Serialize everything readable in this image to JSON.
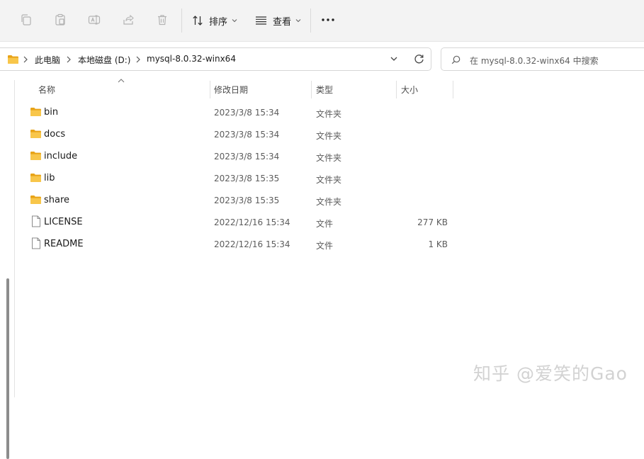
{
  "toolbar": {
    "sort_label": "排序",
    "view_label": "查看",
    "more_label": "···"
  },
  "address": {
    "crumbs": [
      "此电脑",
      "本地磁盘 (D:)",
      "mysql-8.0.32-winx64"
    ]
  },
  "search": {
    "placeholder": "在 mysql-8.0.32-winx64 中搜索"
  },
  "columns": {
    "name": "名称",
    "modified": "修改日期",
    "type": "类型",
    "size": "大小"
  },
  "files": [
    {
      "name": "bin",
      "modified": "2023/3/8 15:34",
      "type": "文件夹",
      "size": "",
      "kind": "folder"
    },
    {
      "name": "docs",
      "modified": "2023/3/8 15:34",
      "type": "文件夹",
      "size": "",
      "kind": "folder"
    },
    {
      "name": "include",
      "modified": "2023/3/8 15:34",
      "type": "文件夹",
      "size": "",
      "kind": "folder"
    },
    {
      "name": "lib",
      "modified": "2023/3/8 15:35",
      "type": "文件夹",
      "size": "",
      "kind": "folder"
    },
    {
      "name": "share",
      "modified": "2023/3/8 15:35",
      "type": "文件夹",
      "size": "",
      "kind": "folder"
    },
    {
      "name": "LICENSE",
      "modified": "2022/12/16 15:34",
      "type": "文件",
      "size": "277 KB",
      "kind": "file"
    },
    {
      "name": "README",
      "modified": "2022/12/16 15:34",
      "type": "文件",
      "size": "1 KB",
      "kind": "file"
    }
  ],
  "watermark": "知乎 @爱笑的Gao",
  "colors": {
    "folder": "#f5c542",
    "toolbar_bg": "#f3f3f3",
    "icon_muted": "#b0b0b0"
  }
}
